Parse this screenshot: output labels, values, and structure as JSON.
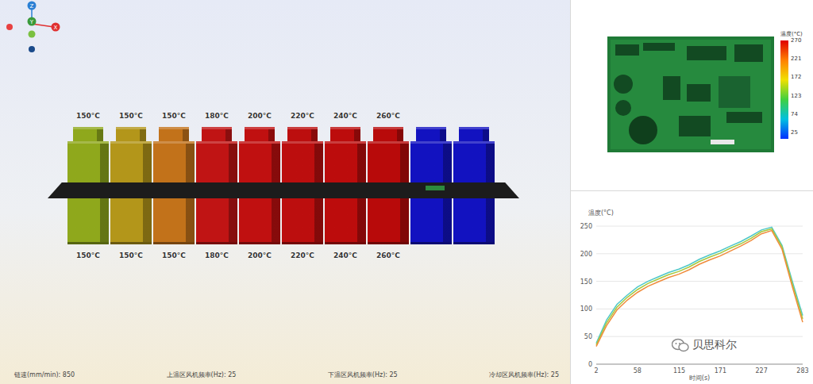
{
  "axis_gizmo": {
    "axes": [
      {
        "label": "Z",
        "color": "#2a7fd4"
      },
      {
        "label": "Y",
        "color": "#3a9a3a"
      },
      {
        "label": "X",
        "color": "#e03030"
      }
    ]
  },
  "oven": {
    "heating_zones": [
      {
        "top_label": "150°C",
        "bottom_label": "150°C",
        "color": "#8fa81c"
      },
      {
        "top_label": "150°C",
        "bottom_label": "150°C",
        "color": "#b3961a"
      },
      {
        "top_label": "150°C",
        "bottom_label": "150°C",
        "color": "#c2721a"
      },
      {
        "top_label": "180°C",
        "bottom_label": "180°C",
        "color": "#c01414"
      },
      {
        "top_label": "200°C",
        "bottom_label": "200°C",
        "color": "#c01010"
      },
      {
        "top_label": "220°C",
        "bottom_label": "220°C",
        "color": "#bc0e0e"
      },
      {
        "top_label": "240°C",
        "bottom_label": "240°C",
        "color": "#bc0c0c"
      },
      {
        "top_label": "260°C",
        "bottom_label": "260°C",
        "color": "#b80a0a"
      }
    ],
    "cooling_zones": [
      {
        "color": "#1212c0"
      },
      {
        "color": "#1212c0"
      }
    ]
  },
  "status_bar": [
    "链速(mm/min): 850",
    "上温区风机频率(Hz): 25",
    "下温区风机频率(Hz): 25",
    "冷却区风机频率(Hz): 25"
  ],
  "color_scale": {
    "title": "温度(°C)",
    "ticks": [
      "270",
      "221",
      "172",
      "123",
      "74",
      "25"
    ]
  },
  "chart": {
    "y_label": "温度(°C)",
    "x_label": "时间(s)",
    "y_ticks": [
      "0",
      "50",
      "100",
      "150",
      "200",
      "250"
    ],
    "x_ticks": [
      "2",
      "58",
      "115",
      "171",
      "227",
      "283"
    ],
    "series": [
      {
        "color": "#4fc8c8",
        "values": [
          38,
          80,
          108,
          125,
          140,
          150,
          158,
          166,
          172,
          180,
          190,
          198,
          205,
          214,
          222,
          232,
          243,
          248,
          215,
          150,
          88
        ]
      },
      {
        "color": "#a8c83c",
        "values": [
          35,
          75,
          103,
          121,
          135,
          146,
          154,
          162,
          168,
          176,
          186,
          194,
          201,
          210,
          218,
          228,
          240,
          245,
          212,
          145,
          82
        ]
      },
      {
        "color": "#f08c3c",
        "values": [
          32,
          70,
          98,
          116,
          130,
          141,
          149,
          157,
          163,
          171,
          181,
          189,
          196,
          205,
          214,
          224,
          236,
          242,
          208,
          140,
          76
        ]
      }
    ]
  },
  "watermark": "贝思科尔"
}
